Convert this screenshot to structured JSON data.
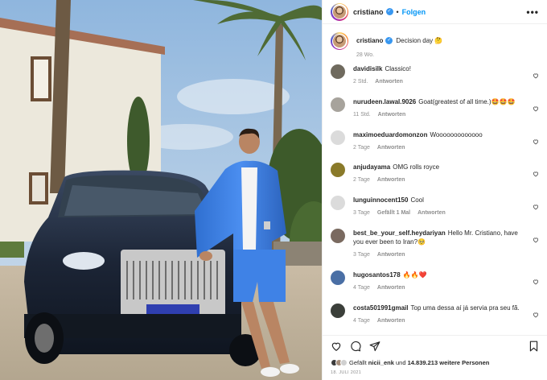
{
  "header": {
    "username": "cristiano",
    "verified": true,
    "separator": "•",
    "follow_label": "Folgen",
    "more_label": "•••"
  },
  "caption": {
    "username": "cristiano",
    "text": "Decision day 🤔",
    "age": "28 Wo."
  },
  "comments": [
    {
      "username": "davidisilk",
      "text": "Classico!",
      "age": "2 Std.",
      "likes": "",
      "reply": "Antworten",
      "avatar_color": "#6f6a5e"
    },
    {
      "username": "nurudeen.lawal.9026",
      "text": "Goat(greatest of all time.)🤩🤩🤩",
      "age": "11 Std.",
      "likes": "",
      "reply": "Antworten",
      "avatar_color": "#a7a39c"
    },
    {
      "username": "maximoeduardomonzon",
      "text": "Wooooooooooooo",
      "age": "2 Tage",
      "likes": "",
      "reply": "Antworten",
      "avatar_color": "#dbdbdb"
    },
    {
      "username": "anjudayama",
      "text": "OMG rolls royce",
      "age": "2 Tage",
      "likes": "",
      "reply": "Antworten",
      "avatar_color": "#8a7a2a"
    },
    {
      "username": "lunguinnocent150",
      "text": "Cool",
      "age": "3 Tage",
      "likes": "Gefällt 1 Mal",
      "reply": "Antworten",
      "avatar_color": "#dbdbdb"
    },
    {
      "username": "best_be_your_self.heydariyan",
      "text": "Hello Mr. Cristiano, have you ever been to Iran?🥺",
      "age": "3 Tage",
      "likes": "",
      "reply": "Antworten",
      "avatar_color": "#7a6a60"
    },
    {
      "username": "hugosantos178",
      "text": "🔥🔥❤️",
      "age": "4 Tage",
      "likes": "",
      "reply": "Antworten",
      "avatar_color": "#4a6fa5"
    },
    {
      "username": "costa501991gmail",
      "text": "Top uma dessa aí já servia pra seu fã.",
      "age": "4 Tage",
      "likes": "",
      "reply": "Antworten",
      "avatar_color": "#3b3f3a"
    }
  ],
  "likes": {
    "prefix": "Gefällt",
    "first_user": "nicii_enk",
    "connector": "und",
    "count": "14.839.213",
    "suffix": "weitere Personen"
  },
  "date": "18. JULI 2021",
  "icons": [
    "heart-icon",
    "comment-icon",
    "share-icon",
    "bookmark-icon",
    "verified-badge-icon",
    "more-options-icon"
  ],
  "colors": {
    "accent": "#0095f6",
    "verified": "#3897f0",
    "muted": "#8e8e8e",
    "like_red": "#ed4956"
  }
}
